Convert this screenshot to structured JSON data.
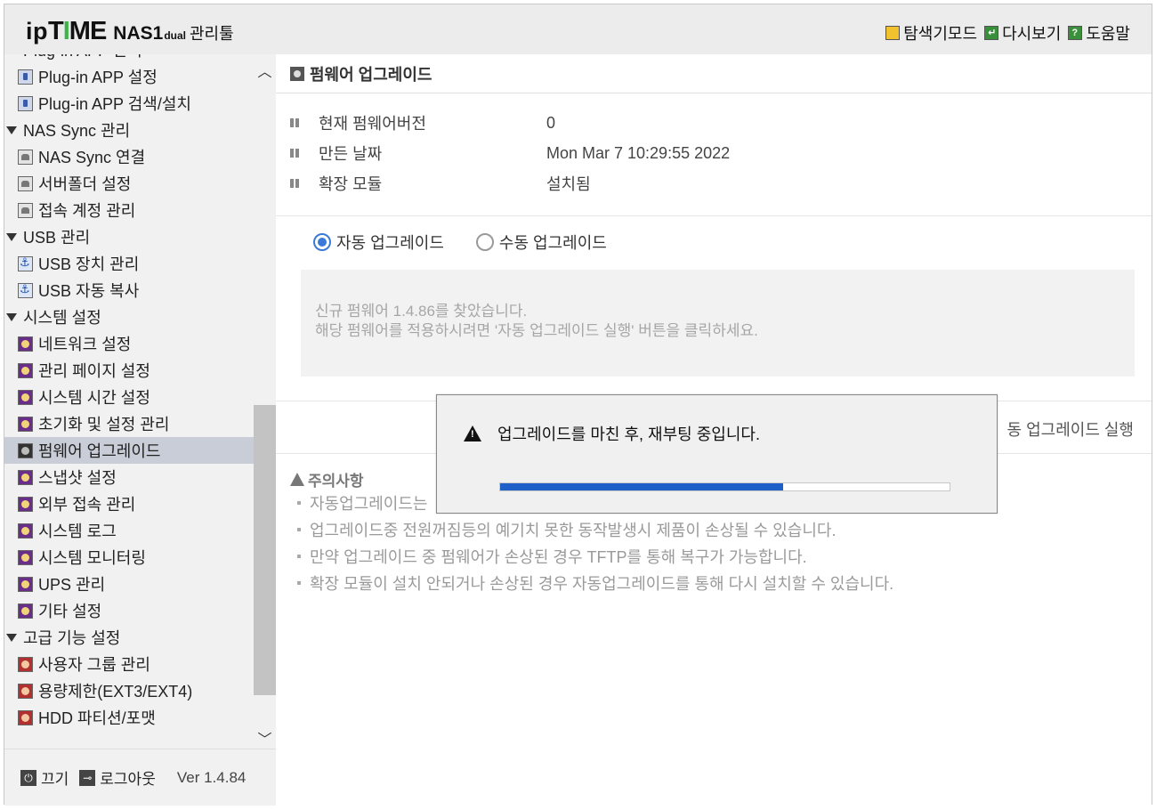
{
  "header": {
    "logo": {
      "ip": "ip",
      "time_t": "T",
      "time_i": "I",
      "time_me": "ME",
      "model": "NAS1",
      "model_sub": "dual",
      "tool": "관리툴"
    },
    "links": [
      {
        "label": "탐색기모드",
        "icon": "folder-icon"
      },
      {
        "label": "다시보기",
        "icon": "refresh-icon"
      },
      {
        "label": "도움말",
        "icon": "help-icon"
      }
    ]
  },
  "sidebar": {
    "items": [
      {
        "label": "Plug-in APP 관리",
        "type": "parent"
      },
      {
        "label": "Plug-in APP 설정",
        "icon": "plugin-icon"
      },
      {
        "label": "Plug-in APP 검색/설치",
        "icon": "plugin-icon"
      },
      {
        "label": "NAS Sync 관리",
        "type": "parent"
      },
      {
        "label": "NAS Sync 연결",
        "icon": "sync-icon"
      },
      {
        "label": "서버폴더 설정",
        "icon": "sync-icon"
      },
      {
        "label": "접속 계정 관리",
        "icon": "sync-icon"
      },
      {
        "label": "USB 관리",
        "type": "parent"
      },
      {
        "label": "USB 장치 관리",
        "icon": "usb-icon"
      },
      {
        "label": "USB 자동 복사",
        "icon": "usb-icon"
      },
      {
        "label": "시스템 설정",
        "type": "parent"
      },
      {
        "label": "네트워크 설정",
        "icon": "system-icon"
      },
      {
        "label": "관리 페이지 설정",
        "icon": "system-icon"
      },
      {
        "label": "시스템 시간 설정",
        "icon": "system-icon"
      },
      {
        "label": "초기화 및 설정 관리",
        "icon": "system-icon"
      },
      {
        "label": "펌웨어 업그레이드",
        "icon": "system-icon",
        "selected": true
      },
      {
        "label": "스냅샷 설정",
        "icon": "system-icon"
      },
      {
        "label": "외부 접속 관리",
        "icon": "system-icon"
      },
      {
        "label": "시스템 로그",
        "icon": "system-icon"
      },
      {
        "label": "시스템 모니터링",
        "icon": "system-icon"
      },
      {
        "label": "UPS 관리",
        "icon": "system-icon"
      },
      {
        "label": "기타 설정",
        "icon": "system-icon"
      },
      {
        "label": "고급 기능 설정",
        "type": "parent"
      },
      {
        "label": "사용자 그룹 관리",
        "icon": "advanced-icon"
      },
      {
        "label": "용량제한(EXT3/EXT4)",
        "icon": "advanced-icon"
      },
      {
        "label": "HDD 파티션/포맷",
        "icon": "advanced-icon"
      }
    ],
    "footer": {
      "power": "끄기",
      "logout": "로그아웃",
      "version": "Ver 1.4.84"
    }
  },
  "main": {
    "title": "펌웨어 업그레이드",
    "info": [
      {
        "label": "현재 펌웨어버전",
        "value": "0"
      },
      {
        "label": "만든 날짜",
        "value": "Mon Mar 7 10:29:55 2022"
      },
      {
        "label": "확장 모듈",
        "value": "설치됨"
      }
    ],
    "mode": {
      "auto": "자동 업그레이드",
      "manual": "수동 업그레이드",
      "selected": "auto"
    },
    "message": {
      "line1": "신규 펌웨어 1.4.86를 찾았습니다.",
      "line2": "해당 펌웨어를 적용하시려면 '자동 업그레이드 실행' 버튼을 클릭하세요."
    },
    "run_button": "동 업그레이드 실행",
    "notes": {
      "title": "주의사항",
      "items": [
        "자동업그레이드는",
        "업그레이드중 전원꺼짐등의 예기치 못한 동작발생시 제품이 손상될 수 있습니다.",
        "만약 업그레이드 중 펌웨어가 손상된 경우 TFTP를 통해 복구가 가능합니다.",
        "확장 모듈이 설치 안되거나 손상된 경우 자동업그레이드를 통해 다시 설치할 수 있습니다."
      ]
    }
  },
  "dialog": {
    "message": "업그레이드를 마친 후, 재부팅 중입니다.",
    "progress": 0.63,
    "progress_color": "#1f5fc8"
  }
}
